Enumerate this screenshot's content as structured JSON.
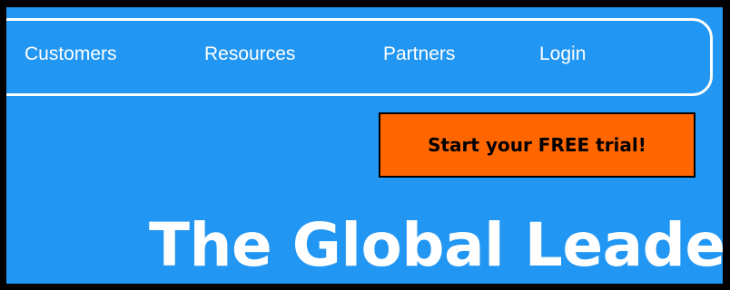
{
  "nav": {
    "items": [
      {
        "label": "Customers"
      },
      {
        "label": "Resources"
      },
      {
        "label": "Partners"
      },
      {
        "label": "Login"
      }
    ]
  },
  "cta": {
    "label": "Start your FREE trial!"
  },
  "hero": {
    "headline": "The Global Leader"
  },
  "colors": {
    "background": "#2196f3",
    "cta_background": "#ff6600",
    "nav_text": "#ffffff",
    "border": "#000000"
  }
}
